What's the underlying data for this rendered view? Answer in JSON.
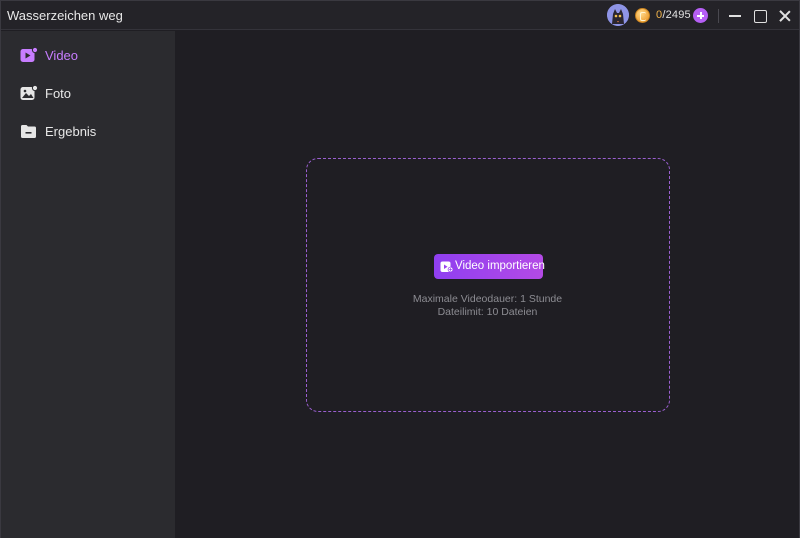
{
  "window": {
    "title": "Wasserzeichen weg"
  },
  "header": {
    "credits_used": "0",
    "credits_total": "/2495",
    "avatar_icon": "avatar-cat-icon",
    "coin_icon": "coin-icon",
    "add_icon": "plus-circle-icon"
  },
  "sidebar": {
    "items": [
      {
        "label": "Video",
        "icon": "video-icon",
        "active": true
      },
      {
        "label": "Foto",
        "icon": "photo-icon",
        "active": false
      },
      {
        "label": "Ergebnis",
        "icon": "folder-icon",
        "active": false
      }
    ]
  },
  "main": {
    "import_button_label": "Video importieren",
    "hint_duration": "Maximale Videodauer: 1 Stunde",
    "hint_limit": "Dateilimit: 10 Dateien"
  },
  "colors": {
    "accent": "#b44ae6",
    "background": "#1f1e23",
    "sidebar": "#2b2b2f",
    "active_label": "#c77dff"
  }
}
